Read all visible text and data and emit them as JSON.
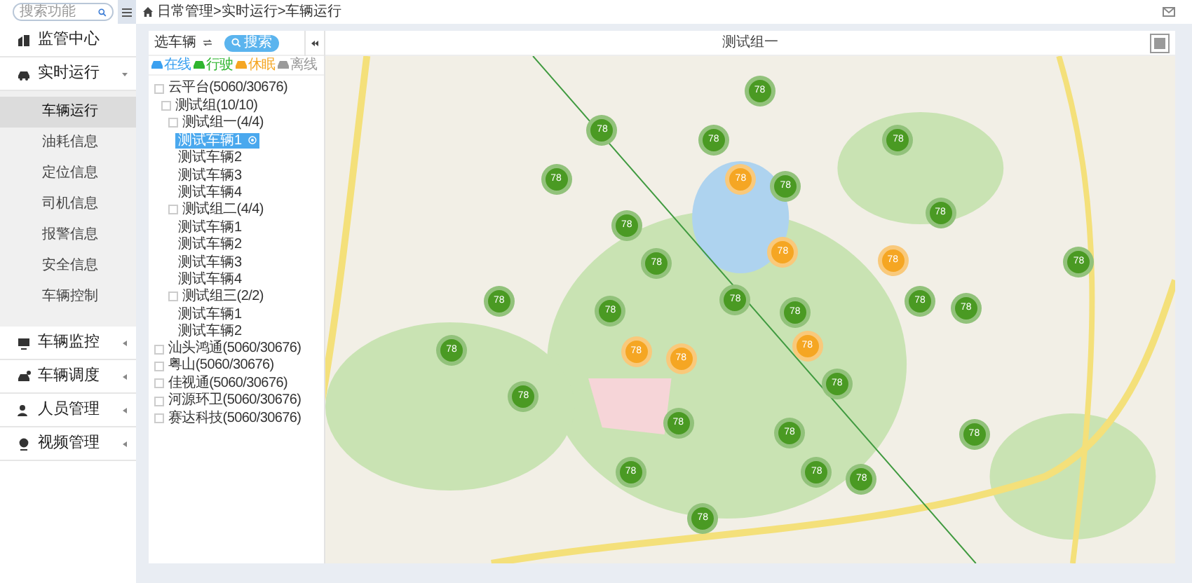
{
  "topbar": {
    "search": {
      "placeholder": "搜索功能"
    },
    "breadcrumb": "日常管理>实时运行>车辆运行"
  },
  "sidebar": {
    "items": [
      {
        "kind": "link",
        "label": "监管中心"
      },
      {
        "kind": "group",
        "label": "实时运行",
        "expanded": true,
        "children": [
          {
            "label": "车辆运行",
            "selected": true
          },
          {
            "label": "油耗信息",
            "selected": false
          },
          {
            "label": "定位信息",
            "selected": false
          },
          {
            "label": "司机信息",
            "selected": false
          },
          {
            "label": "报警信息",
            "selected": false
          },
          {
            "label": "安全信息",
            "selected": false
          },
          {
            "label": "车辆控制",
            "selected": false
          }
        ]
      },
      {
        "kind": "group",
        "label": "车辆监控",
        "expanded": false
      },
      {
        "kind": "group",
        "label": "车辆调度",
        "expanded": false
      },
      {
        "kind": "group",
        "label": "人员管理",
        "expanded": false
      },
      {
        "kind": "group",
        "label": "视频管理",
        "expanded": false
      }
    ]
  },
  "vehicle_panel": {
    "title": "选车辆",
    "search_button": "搜索",
    "legend": [
      {
        "label": "在线",
        "color": "#3aa0f0"
      },
      {
        "label": "行驶",
        "color": "#2fb52f"
      },
      {
        "label": "休眠",
        "color": "#f5a623"
      },
      {
        "label": "离线",
        "color": "#9a9a9a"
      }
    ],
    "tree": [
      {
        "kind": "group",
        "label": "云平台(5060/30676)",
        "checked": false,
        "children": [
          {
            "kind": "group",
            "label": "测试组(10/10)",
            "checked": false,
            "children": [
              {
                "kind": "group",
                "label": "测试组一(4/4)",
                "checked": false,
                "children": [
                  {
                    "kind": "vehicle",
                    "label": "测试车辆1",
                    "selected": true
                  },
                  {
                    "kind": "vehicle",
                    "label": "测试车辆2",
                    "selected": false
                  },
                  {
                    "kind": "vehicle",
                    "label": "测试车辆3",
                    "selected": false
                  },
                  {
                    "kind": "vehicle",
                    "label": "测试车辆4",
                    "selected": false
                  }
                ]
              },
              {
                "kind": "group",
                "label": "测试组二(4/4)",
                "checked": false,
                "children": [
                  {
                    "kind": "vehicle",
                    "label": "测试车辆1",
                    "selected": false
                  },
                  {
                    "kind": "vehicle",
                    "label": "测试车辆2",
                    "selected": false
                  },
                  {
                    "kind": "vehicle",
                    "label": "测试车辆3",
                    "selected": false
                  },
                  {
                    "kind": "vehicle",
                    "label": "测试车辆4",
                    "selected": false
                  }
                ]
              },
              {
                "kind": "group",
                "label": "测试组三(2/2)",
                "checked": false,
                "children": [
                  {
                    "kind": "vehicle",
                    "label": "测试车辆1",
                    "selected": false
                  },
                  {
                    "kind": "vehicle",
                    "label": "测试车辆2",
                    "selected": false
                  }
                ]
              }
            ]
          }
        ]
      },
      {
        "kind": "group",
        "label": "汕头鸿通(5060/30676)",
        "checked": false
      },
      {
        "kind": "group",
        "label": "粤山(5060/30676)",
        "checked": false
      },
      {
        "kind": "group",
        "label": "佳视通(5060/30676)",
        "checked": false
      },
      {
        "kind": "group",
        "label": "河源环卫(5060/30676)",
        "checked": false
      },
      {
        "kind": "group",
        "label": "赛达科技(5060/30676)",
        "checked": false
      }
    ]
  },
  "map": {
    "title": "测试组一",
    "markers": [
      {
        "label": "78",
        "color": "#4a9a23"
      },
      {
        "label": "78",
        "color": "#4a9a23"
      },
      {
        "label": "78",
        "color": "#4a9a23"
      },
      {
        "label": "78",
        "color": "#4a9a23"
      },
      {
        "label": "78",
        "color": "#4a9a23"
      },
      {
        "label": "78",
        "color": "#4a9a23"
      },
      {
        "label": "78",
        "color": "#4a9a23"
      },
      {
        "label": "78",
        "color": "#4a9a23"
      },
      {
        "label": "78",
        "color": "#4a9a23"
      },
      {
        "label": "78",
        "color": "#4a9a23"
      },
      {
        "label": "78",
        "color": "#4a9a23"
      },
      {
        "label": "78",
        "color": "#4a9a23"
      },
      {
        "label": "78",
        "color": "#4a9a23"
      },
      {
        "label": "78",
        "color": "#4a9a23"
      },
      {
        "label": "78",
        "color": "#4a9a23"
      },
      {
        "label": "78",
        "color": "#4a9a23"
      },
      {
        "label": "78",
        "color": "#4a9a23"
      },
      {
        "label": "78",
        "color": "#4a9a23"
      },
      {
        "label": "78",
        "color": "#4a9a23"
      },
      {
        "label": "78",
        "color": "#4a9a23"
      },
      {
        "label": "78",
        "color": "#4a9a23"
      },
      {
        "label": "78",
        "color": "#4a9a23"
      },
      {
        "label": "78",
        "color": "#4a9a23"
      },
      {
        "label": "78",
        "color": "#4a9a23"
      },
      {
        "label": "78",
        "color": "#4a9a23"
      },
      {
        "label": "78",
        "color": "#4a9a23"
      },
      {
        "label": "78",
        "color": "#f5a623"
      },
      {
        "label": "78",
        "color": "#f5a623"
      },
      {
        "label": "78",
        "color": "#f5a623"
      },
      {
        "label": "78",
        "color": "#f5a623"
      },
      {
        "label": "78",
        "color": "#f5a623"
      },
      {
        "label": "78",
        "color": "#f5a623"
      }
    ]
  }
}
